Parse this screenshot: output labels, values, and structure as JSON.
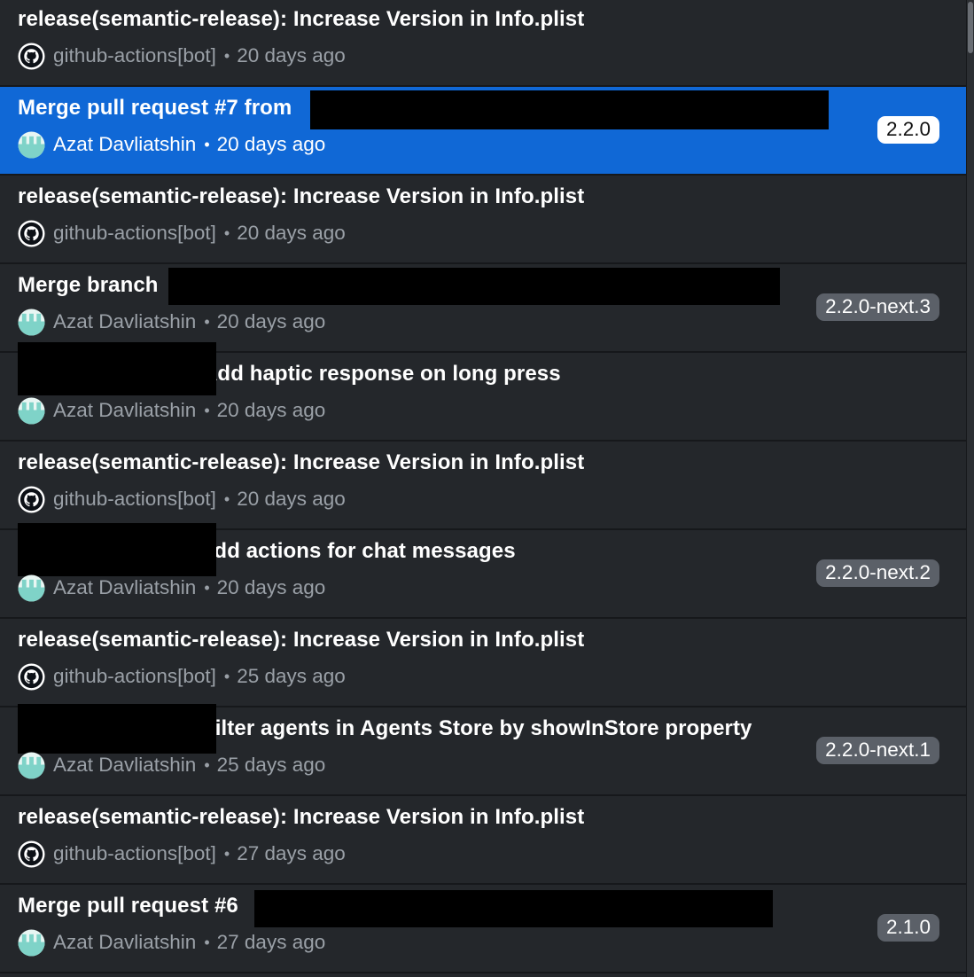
{
  "commits": [
    {
      "title": "release(semantic-release): Increase Version in Info.plist",
      "author": "github-actions[bot]",
      "time": "20 days ago",
      "avatar": "github-octocat-icon",
      "tag": "",
      "selected": false
    },
    {
      "title": "Merge pull request #7 from",
      "author": "Azat Davliatshin",
      "time": "20 days ago",
      "avatar": "user-avatar",
      "tag": "2.2.0",
      "selected": true
    },
    {
      "title": "release(semantic-release): Increase Version in Info.plist",
      "author": "github-actions[bot]",
      "time": "20 days ago",
      "avatar": "github-octocat-icon",
      "tag": "",
      "selected": false
    },
    {
      "title": "Merge branch",
      "author": "Azat Davliatshin",
      "time": "20 days ago",
      "avatar": "user-avatar",
      "tag": "2.2.0-next.3",
      "selected": false
    },
    {
      "title": "Add haptic response on long press",
      "author": "Azat Davliatshin",
      "time": "20 days ago",
      "avatar": "user-avatar",
      "tag": "",
      "selected": false
    },
    {
      "title": "release(semantic-release): Increase Version in Info.plist",
      "author": "github-actions[bot]",
      "time": "20 days ago",
      "avatar": "github-octocat-icon",
      "tag": "",
      "selected": false
    },
    {
      "title": "Add actions for chat messages",
      "author": "Azat Davliatshin",
      "time": "20 days ago",
      "avatar": "user-avatar",
      "tag": "2.2.0-next.2",
      "selected": false
    },
    {
      "title": "release(semantic-release): Increase Version in Info.plist",
      "author": "github-actions[bot]",
      "time": "25 days ago",
      "avatar": "github-octocat-icon",
      "tag": "",
      "selected": false
    },
    {
      "title": "Filter agents in Agents Store by showInStore property",
      "author": "Azat Davliatshin",
      "time": "25 days ago",
      "avatar": "user-avatar",
      "tag": "2.2.0-next.1",
      "selected": false
    },
    {
      "title": "release(semantic-release): Increase Version in Info.plist",
      "author": "github-actions[bot]",
      "time": "27 days ago",
      "avatar": "github-octocat-icon",
      "tag": "",
      "selected": false
    },
    {
      "title": "Merge pull request #6",
      "author": "Azat Davliatshin",
      "time": "27 days ago",
      "avatar": "user-avatar",
      "tag": "2.1.0",
      "selected": false
    }
  ],
  "separator": "•",
  "colors": {
    "background": "#24272b",
    "selected": "#1068d6",
    "tag": "#5b6068",
    "meta": "#9aa0a7",
    "avatar_teal": "#7fd3c8"
  }
}
